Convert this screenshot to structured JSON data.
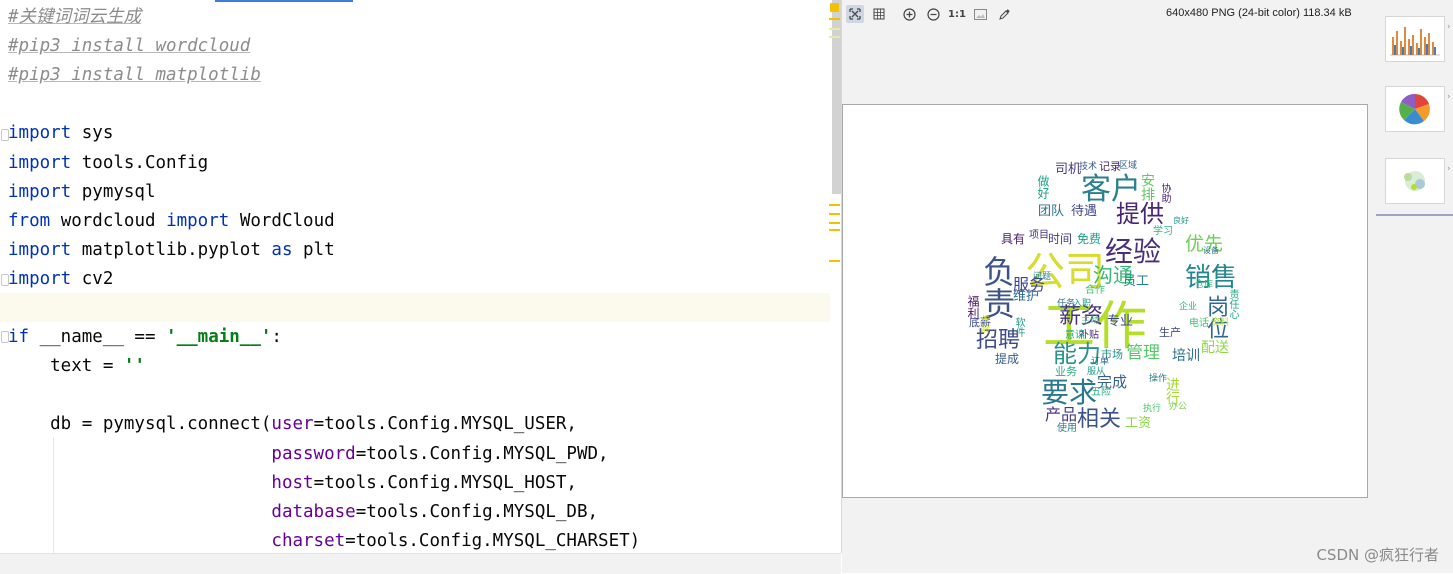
{
  "editor": {
    "lines": [
      {
        "segs": [
          {
            "c": "cm",
            "t": "#关键词词云生成"
          }
        ]
      },
      {
        "segs": [
          {
            "c": "cm",
            "t": "#pip3 install wordcloud"
          }
        ]
      },
      {
        "segs": [
          {
            "c": "cm",
            "t": "#pip3 install matplotlib"
          }
        ]
      },
      {
        "segs": []
      },
      {
        "segs": [
          {
            "c": "kw",
            "t": "import"
          },
          {
            "c": "",
            "t": " sys"
          }
        ]
      },
      {
        "segs": [
          {
            "c": "kw",
            "t": "import"
          },
          {
            "c": "",
            "t": " tools.Config"
          }
        ]
      },
      {
        "segs": [
          {
            "c": "kw",
            "t": "import"
          },
          {
            "c": "",
            "t": " pymysql"
          }
        ]
      },
      {
        "segs": [
          {
            "c": "kw",
            "t": "from"
          },
          {
            "c": "",
            "t": " wordcloud "
          },
          {
            "c": "kw",
            "t": "import"
          },
          {
            "c": "",
            "t": " WordCloud"
          }
        ]
      },
      {
        "segs": [
          {
            "c": "kw",
            "t": "import"
          },
          {
            "c": "",
            "t": " matplotlib.pyplot "
          },
          {
            "c": "kw",
            "t": "as"
          },
          {
            "c": "",
            "t": " plt"
          }
        ]
      },
      {
        "segs": [
          {
            "c": "kw",
            "t": "import"
          },
          {
            "c": "",
            "t": " cv2"
          }
        ]
      },
      {
        "segs": []
      },
      {
        "segs": [
          {
            "c": "kw",
            "t": "if"
          },
          {
            "c": "",
            "t": " __name__ == "
          },
          {
            "c": "str",
            "t": "'__main__'"
          },
          {
            "c": "",
            "t": ":"
          }
        ]
      },
      {
        "segs": [
          {
            "c": "",
            "t": "    text = "
          },
          {
            "c": "str",
            "t": "''"
          }
        ]
      },
      {
        "segs": []
      },
      {
        "segs": [
          {
            "c": "",
            "t": "    db = pymysql.connect("
          },
          {
            "c": "param",
            "t": "user"
          },
          {
            "c": "",
            "t": "=tools.Config.MYSQL_USER,"
          }
        ]
      },
      {
        "segs": [
          {
            "c": "",
            "t": "                         "
          },
          {
            "c": "param",
            "t": "password"
          },
          {
            "c": "",
            "t": "=tools.Config.MYSQL_PWD,"
          }
        ]
      },
      {
        "segs": [
          {
            "c": "",
            "t": "                         "
          },
          {
            "c": "param",
            "t": "host"
          },
          {
            "c": "",
            "t": "=tools.Config.MYSQL_HOST,"
          }
        ]
      },
      {
        "segs": [
          {
            "c": "",
            "t": "                         "
          },
          {
            "c": "param",
            "t": "database"
          },
          {
            "c": "",
            "t": "=tools.Config.MYSQL_DB,"
          }
        ]
      },
      {
        "segs": [
          {
            "c": "",
            "t": "                         "
          },
          {
            "c": "param",
            "t": "charset"
          },
          {
            "c": "",
            "t": "=tools.Config.MYSQL_CHARSET)"
          }
        ]
      }
    ]
  },
  "viewer": {
    "toolbar": {
      "fit_icon": "fit-screen-icon",
      "grid_icon": "grid-icon",
      "zoom_in_icon": "zoom-in-icon",
      "zoom_out_icon": "zoom-out-icon",
      "actual_size_label": "1:1",
      "background_icon": "background-icon",
      "color_picker_icon": "color-picker-icon"
    },
    "image_info": "640x480 PNG (24-bit color) 118.34 kB",
    "watermark": "CSDN @疯狂行者"
  },
  "colors": {
    "keyword": "#0033b3",
    "comment": "#8c8c8c",
    "string": "#067d17",
    "parameter": "#660099",
    "caret_line": "#fcfaed"
  },
  "wordcloud": {
    "words": [
      {
        "t": "工作",
        "c": "#b5de2b"
      },
      {
        "t": "公司",
        "c": "#d6dd2a"
      },
      {
        "t": "经验",
        "c": "#472f7d"
      },
      {
        "t": "客户",
        "c": "#2b7f8e"
      },
      {
        "t": "提供",
        "c": "#482475"
      },
      {
        "t": "要求",
        "c": "#2a788e"
      },
      {
        "t": "销售",
        "c": "#22888d"
      },
      {
        "t": "负责",
        "c": "#3b528b"
      },
      {
        "t": "能力",
        "c": "#2b918c"
      },
      {
        "t": "薪资",
        "c": "#463480"
      },
      {
        "t": "招聘",
        "c": "#3e4a89"
      },
      {
        "t": "沟通",
        "c": "#35b779"
      },
      {
        "t": "优先",
        "c": "#6ece58"
      },
      {
        "t": "岗位",
        "c": "#31688e"
      },
      {
        "t": "相关",
        "c": "#3b528b"
      },
      {
        "t": "服务",
        "c": "#414487"
      },
      {
        "t": "管理",
        "c": "#56c667"
      },
      {
        "t": "完成",
        "c": "#355f8d"
      },
      {
        "t": "产品",
        "c": "#443a83"
      },
      {
        "t": "员工",
        "c": "#26828e"
      },
      {
        "t": "安排",
        "c": "#5ec962"
      },
      {
        "t": "培训",
        "c": "#2d708e"
      },
      {
        "t": "配送",
        "c": "#8fd744"
      },
      {
        "t": "进行",
        "c": "#a5db36"
      },
      {
        "t": "专业",
        "c": "#3e4989"
      },
      {
        "t": "市场",
        "c": "#21918c"
      },
      {
        "t": "生产",
        "c": "#404688"
      },
      {
        "t": "时间",
        "c": "#433e85"
      },
      {
        "t": "免费",
        "c": "#1f9e89"
      },
      {
        "t": "具有",
        "c": "#481a6c"
      },
      {
        "t": "项目",
        "c": "#46327e"
      },
      {
        "t": "团队",
        "c": "#2c728e"
      },
      {
        "t": "待遇",
        "c": "#3f4788"
      },
      {
        "t": "司机",
        "c": "#453781"
      },
      {
        "t": "做好",
        "c": "#1fa088"
      },
      {
        "t": "福利",
        "c": "#471365"
      },
      {
        "t": "底薪",
        "c": "#3c4f8a"
      },
      {
        "t": "提成",
        "c": "#365c8d"
      },
      {
        "t": "维护",
        "c": "#2e6d8e"
      },
      {
        "t": "工资",
        "c": "#8bd646"
      },
      {
        "t": "业务",
        "c": "#28ae80"
      },
      {
        "t": "记录",
        "c": "#482576"
      },
      {
        "t": "技术",
        "c": "#3a548c"
      },
      {
        "t": "学习",
        "c": "#31b57b"
      },
      {
        "t": "五险",
        "c": "#27ad81"
      },
      {
        "t": "使用",
        "c": "#25848e"
      },
      {
        "t": "补贴",
        "c": "#472c7a"
      },
      {
        "t": "电话",
        "c": "#4ac16d"
      },
      {
        "t": "协助",
        "c": "#481f70"
      },
      {
        "t": "区域",
        "c": "#33638d"
      },
      {
        "t": "意识",
        "c": "#25ab82"
      },
      {
        "t": "责任心",
        "c": "#22a785"
      },
      {
        "t": "合作",
        "c": "#3dbc74"
      },
      {
        "t": "订单",
        "c": "#32658e"
      },
      {
        "t": "服从",
        "c": "#1e9b8a"
      },
      {
        "t": "任务",
        "c": "#2a768e"
      },
      {
        "t": "入职",
        "c": "#20a386"
      },
      {
        "t": "操作",
        "c": "#287d8e"
      },
      {
        "t": "办公",
        "c": "#7ad151"
      },
      {
        "t": "年龄",
        "c": "#d2e21b"
      },
      {
        "t": "资料",
        "c": "#a8db34"
      },
      {
        "t": "企业",
        "c": "#2db27d"
      },
      {
        "t": "执行",
        "c": "#4cc26c"
      },
      {
        "t": "软件",
        "c": "#1f988b"
      },
      {
        "t": "设备",
        "c": "#2a768e"
      },
      {
        "t": "仓库",
        "c": "#2fb47c"
      },
      {
        "t": "问题",
        "c": "#24868e"
      },
      {
        "t": "主动",
        "c": "#3dbc74"
      },
      {
        "t": "良好",
        "c": "#20928c"
      }
    ]
  }
}
